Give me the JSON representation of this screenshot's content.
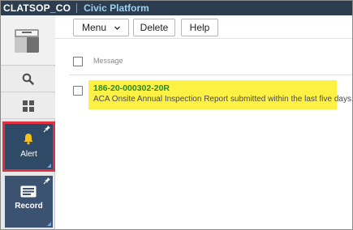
{
  "header": {
    "agency": "CLATSOP_CO",
    "product": "Civic Platform"
  },
  "sidebar": {
    "alert_label": "Alert",
    "record_label": "Record"
  },
  "toolbar": {
    "menu_label": "Menu",
    "delete_label": "Delete",
    "help_label": "Help"
  },
  "table": {
    "header_label": "Message",
    "rows": [
      {
        "record_id": "186-20-000302-20R",
        "message": "ACA Onsite Annual Inspection Report submitted within the last five days."
      }
    ]
  },
  "colors": {
    "topbar": "#2b3d4f",
    "product_text": "#9fd0ee",
    "alert_border": "#e0313f",
    "tile_bg": "#2f4a66",
    "highlight": "#fdf143",
    "record_id_text": "#2b8a2b"
  },
  "icons": {
    "logo": "launchpad-icon",
    "search": "search-icon",
    "apps": "grid-icon",
    "alert": "bell-icon",
    "record": "record-card-icon",
    "pin": "pin-icon",
    "menu_chevron": "chevron-down-icon"
  }
}
